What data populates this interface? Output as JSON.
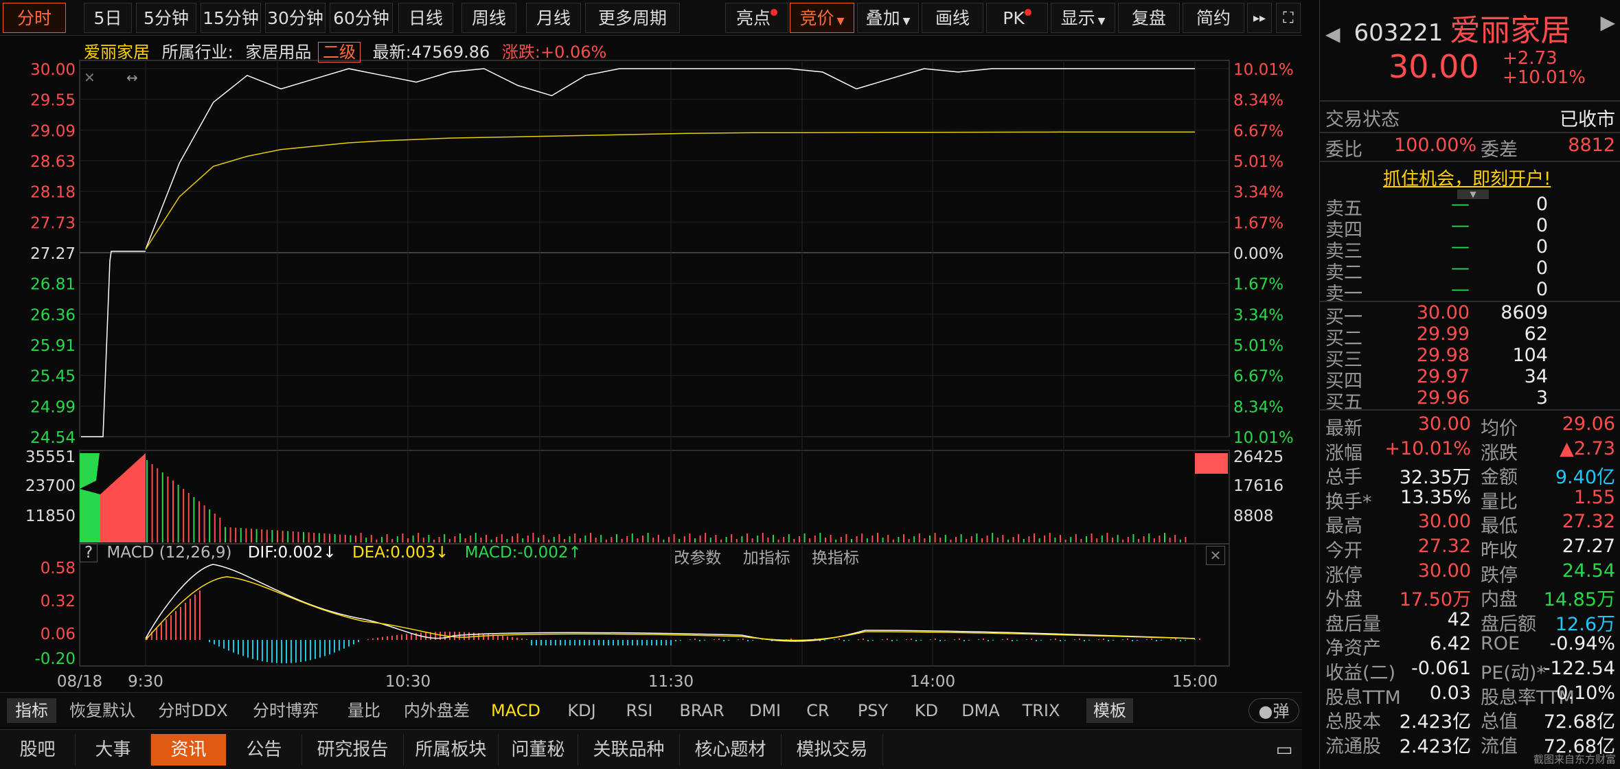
{
  "toolbar": {
    "tabs": [
      "分时",
      "5日",
      "5分钟",
      "15分钟",
      "30分钟",
      "60分钟",
      "日线",
      "周线",
      "月线",
      "更多周期"
    ],
    "right": [
      "亮点",
      "竞价",
      "叠加",
      "画线",
      "PK",
      "显示",
      "复盘",
      "简约"
    ]
  },
  "info": {
    "name": "爱丽家居",
    "industry_label": "所属行业:",
    "industry": "家居用品",
    "level": "二级",
    "latest": "最新:47569.86",
    "change": "涨跌:+0.06%"
  },
  "price_axis": {
    "left": [
      "30.00",
      "29.55",
      "29.09",
      "28.63",
      "28.18",
      "27.73",
      "27.27",
      "26.81",
      "26.36",
      "25.91",
      "25.45",
      "24.99",
      "24.54"
    ],
    "right": [
      "10.01%",
      "8.34%",
      "6.67%",
      "5.01%",
      "3.34%",
      "1.67%",
      "0.00%",
      "1.67%",
      "3.34%",
      "5.01%",
      "6.67%",
      "8.34%",
      "10.01%"
    ]
  },
  "vol_axis": {
    "left": [
      "35551",
      "23700",
      "11850"
    ],
    "right": [
      "26425",
      "17616",
      "8808"
    ]
  },
  "macd": {
    "q": "?",
    "name": "MACD (12,26,9)",
    "dif": "DIF:0.002↓",
    "dea": "DEA:0.003↓",
    "macd": "MACD:-0.002↑",
    "axis": [
      "0.58",
      "0.32",
      "0.06",
      "-0.20"
    ],
    "tools": [
      "改参数",
      "加指标",
      "换指标"
    ]
  },
  "time_axis": [
    "08/18",
    "9:30",
    "10:30",
    "11:30",
    "14:00",
    "15:00"
  ],
  "indicators": [
    "指标",
    "恢复默认",
    "分时DDX",
    "分时博弈",
    "量比",
    "内外盘差",
    "MACD",
    "KDJ",
    "RSI",
    "BRAR",
    "DMI",
    "CR",
    "PSY",
    "KD",
    "DMA",
    "TRIX",
    "模板"
  ],
  "toggle": "弹",
  "tabs": [
    "股吧",
    "大事",
    "资讯",
    "公告",
    "研究报告",
    "所属板块",
    "问董秘",
    "关联品种",
    "核心题材",
    "模拟交易"
  ],
  "quote": {
    "code": "603221",
    "name": "爱丽家居",
    "price": "30.00",
    "chg": "+2.73",
    "pct": "+10.01%",
    "status_label": "交易状态",
    "status": "已收市",
    "wb_label": "委比",
    "wb": "100.00%",
    "wc_label": "委差",
    "wc": "8812",
    "ad": "抓住机会，即刻开户!",
    "sells": [
      {
        "l": "卖五",
        "p": "—",
        "v": "0"
      },
      {
        "l": "卖四",
        "p": "—",
        "v": "0"
      },
      {
        "l": "卖三",
        "p": "—",
        "v": "0"
      },
      {
        "l": "卖二",
        "p": "—",
        "v": "0"
      },
      {
        "l": "卖一",
        "p": "—",
        "v": "0"
      }
    ],
    "buys": [
      {
        "l": "买一",
        "p": "30.00",
        "v": "8609"
      },
      {
        "l": "买二",
        "p": "29.99",
        "v": "62"
      },
      {
        "l": "买三",
        "p": "29.98",
        "v": "104"
      },
      {
        "l": "买四",
        "p": "29.97",
        "v": "34"
      },
      {
        "l": "买五",
        "p": "29.96",
        "v": "3"
      }
    ],
    "stats": [
      [
        "最新",
        "30.00",
        "均价",
        "29.06"
      ],
      [
        "涨幅",
        "+10.01%",
        "涨跌",
        "▲2.73"
      ],
      [
        "总手",
        "32.35万",
        "金额",
        "9.40亿"
      ],
      [
        "换手*",
        "13.35%",
        "量比",
        "1.55"
      ],
      [
        "最高",
        "30.00",
        "最低",
        "27.32"
      ],
      [
        "今开",
        "27.32",
        "昨收",
        "27.27"
      ],
      [
        "涨停",
        "30.00",
        "跌停",
        "24.54"
      ],
      [
        "外盘",
        "17.50万",
        "内盘",
        "14.85万"
      ],
      [
        "盘后量",
        "42",
        "盘后额",
        "12.6万"
      ],
      [
        "净资产",
        "6.42",
        "ROE",
        "-0.94%"
      ],
      [
        "收益(二)",
        "-0.061",
        "PE(动)*",
        "-122.54"
      ],
      [
        "股息TTM",
        "0.03",
        "股息率TTM",
        "0.10%"
      ],
      [
        "总股本",
        "2.423亿",
        "总值",
        "72.68亿"
      ],
      [
        "流通股",
        "2.423亿",
        "流值",
        "72.68亿"
      ]
    ],
    "watermark": "截图来自东方财富"
  },
  "chart_data": {
    "type": "line",
    "title": "",
    "x": [
      "09:30",
      "09:35",
      "09:40",
      "09:45",
      "09:50",
      "09:55",
      "10:00",
      "10:05",
      "10:10",
      "10:15",
      "10:20",
      "10:25",
      "10:30",
      "10:35",
      "10:40",
      "10:50",
      "11:00",
      "11:10",
      "11:20",
      "11:30",
      "13:10",
      "13:20",
      "13:30",
      "13:40",
      "13:50",
      "14:00",
      "14:10",
      "14:20",
      "14:30",
      "14:40",
      "14:50",
      "15:00"
    ],
    "series": [
      {
        "values": [
          27.32,
          28.6,
          29.5,
          29.9,
          29.7,
          29.85,
          30.0,
          29.9,
          29.8,
          29.95,
          30.0,
          29.75,
          29.6,
          29.9,
          30.0,
          30.0,
          30.0,
          30.0,
          30.0,
          30.0,
          29.95,
          29.7,
          29.85,
          30.0,
          29.95,
          30.0,
          30.0,
          30.0,
          30.0,
          30.0,
          30.0,
          30.0
        ]
      },
      {
        "values": [
          27.32,
          28.1,
          28.55,
          28.7,
          28.8,
          28.85,
          28.9,
          28.93,
          28.95,
          28.97,
          28.98,
          28.99,
          29.0,
          29.01,
          29.02,
          29.03,
          29.04,
          29.045,
          29.05,
          29.05,
          29.052,
          29.054,
          29.055,
          29.056,
          29.057,
          29.058,
          29.059,
          29.06,
          29.06,
          29.06,
          29.06,
          29.06
        ]
      }
    ],
    "ylim": [
      24.54,
      30.0
    ]
  }
}
